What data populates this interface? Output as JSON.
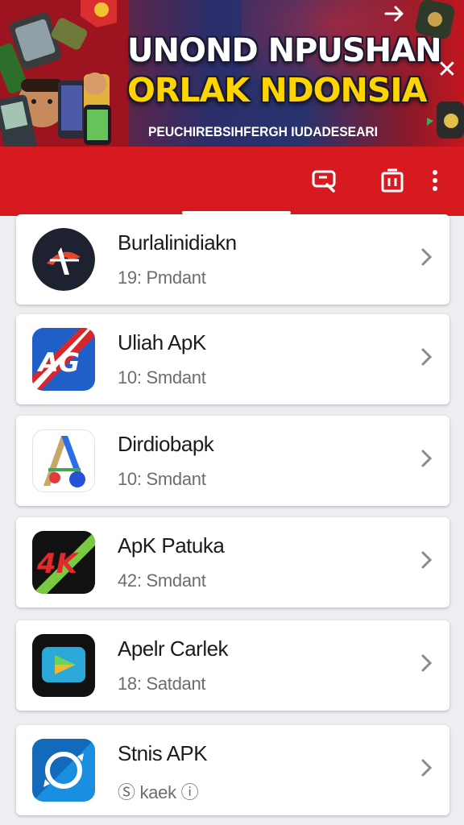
{
  "banner": {
    "title_line1": "UNOND NPUSHAN",
    "title_line2": "ORLAK NDONSIA",
    "subtitle": "PEUCHIREBSIHFERGH IUDADESEARI",
    "close_symbol": "✕"
  },
  "toolbar": {
    "icons": [
      "search-icon",
      "list-icon",
      "more-icon"
    ]
  },
  "apps": [
    {
      "title": "Burlalinidiakn",
      "subtitle": "19: Pmdant",
      "icon": "burlalinidiakn-logo"
    },
    {
      "title": "Uliah ApK",
      "subtitle": "10: Smdant",
      "icon": "uliah-apk-logo"
    },
    {
      "title": "Dirdiobapk",
      "subtitle": "10: Smdant",
      "icon": "dirdiobapk-logo"
    },
    {
      "title": "ApK Patuka",
      "subtitle": "42: Smdant",
      "icon": "apk-patuka-logo"
    },
    {
      "title": "Apelr Carlek",
      "subtitle": "18: Satdant",
      "icon": "apelr-carlek-logo"
    },
    {
      "title": "Stnis APK",
      "subtitle": "Ⓢ kaek   ⓘ",
      "icon": "stnis-apk-logo"
    }
  ],
  "colors": {
    "toolbar_red": "#d61a20",
    "title_yellow": "#ffd400",
    "background": "#eceef2"
  }
}
